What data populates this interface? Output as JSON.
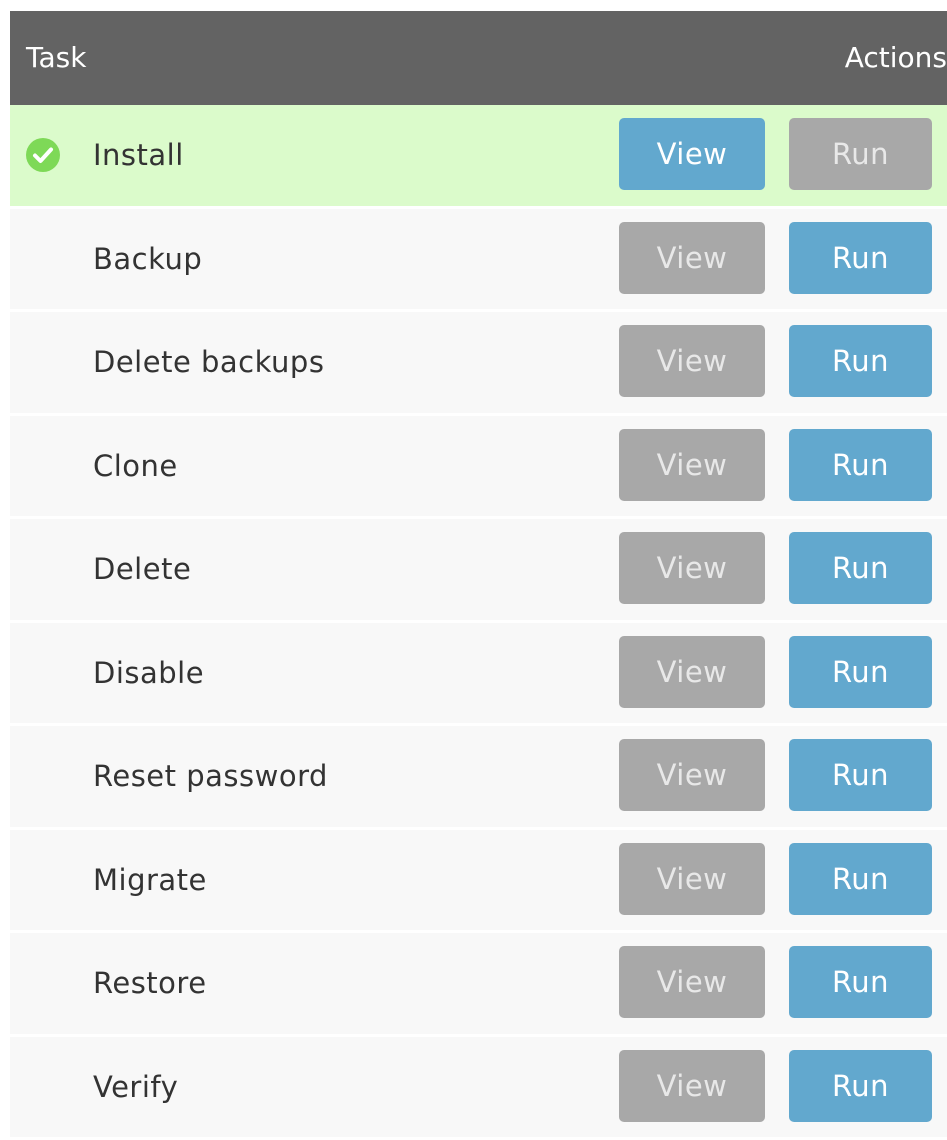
{
  "header": {
    "task_col": "Task",
    "actions_col": "Actions"
  },
  "rows": [
    {
      "label": "Install",
      "status": "success",
      "view_label": "View",
      "run_label": "Run",
      "view_enabled": true,
      "run_enabled": false
    },
    {
      "label": "Backup",
      "status": "none",
      "view_label": "View",
      "run_label": "Run",
      "view_enabled": false,
      "run_enabled": true
    },
    {
      "label": "Delete backups",
      "status": "none",
      "view_label": "View",
      "run_label": "Run",
      "view_enabled": false,
      "run_enabled": true
    },
    {
      "label": "Clone",
      "status": "none",
      "view_label": "View",
      "run_label": "Run",
      "view_enabled": false,
      "run_enabled": true
    },
    {
      "label": "Delete",
      "status": "none",
      "view_label": "View",
      "run_label": "Run",
      "view_enabled": false,
      "run_enabled": true
    },
    {
      "label": "Disable",
      "status": "none",
      "view_label": "View",
      "run_label": "Run",
      "view_enabled": false,
      "run_enabled": true
    },
    {
      "label": "Reset password",
      "status": "none",
      "view_label": "View",
      "run_label": "Run",
      "view_enabled": false,
      "run_enabled": true
    },
    {
      "label": "Migrate",
      "status": "none",
      "view_label": "View",
      "run_label": "Run",
      "view_enabled": false,
      "run_enabled": true
    },
    {
      "label": "Restore",
      "status": "none",
      "view_label": "View",
      "run_label": "Run",
      "view_enabled": false,
      "run_enabled": true
    },
    {
      "label": "Verify",
      "status": "none",
      "view_label": "View",
      "run_label": "Run",
      "view_enabled": false,
      "run_enabled": true
    }
  ],
  "icons": {
    "status_success": "check-circle-icon"
  },
  "colors": {
    "header_bg": "#636363",
    "success_row_bg": "#dbfbcb",
    "row_bg": "#f8f8f8",
    "button_active": "#62a8ce",
    "button_disabled": "#a8a8a8",
    "success_icon": "#7ed957"
  }
}
